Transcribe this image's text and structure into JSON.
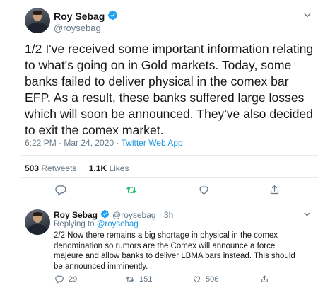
{
  "main_tweet": {
    "author_name": "Roy Sebag",
    "handle": "@roysebag",
    "text": "1/2 I've received some important information relating to what's going on in Gold markets. Today, some banks failed to deliver physical in the comex bar EFP. As a result, these banks suffered large losses which will soon be announced. They've also decided to exit the comex market.",
    "time": "6:22 PM · Mar 24, 2020 · ",
    "source": "Twitter Web App",
    "retweets_count": "503",
    "retweets_label": "Retweets",
    "likes_count": "1.1K",
    "likes_label": "Likes"
  },
  "reply_tweet": {
    "author_name": "Roy Sebag",
    "handle": "@roysebag",
    "age": "· 3h",
    "replying_prefix": "Replying to ",
    "replying_to": "@roysebag",
    "text": "2/2 Now there remains a big shortage in physical in the comex denomination so rumors are the Comex will announce a force majeure and allow banks to deliver LBMA bars instead. This should be announced imminently.",
    "reply_count": "29",
    "retweet_count": "151",
    "like_count": "506"
  },
  "colors": {
    "accent": "#1da1f2",
    "retweet_green": "#17bf63",
    "secondary_text": "#657786"
  }
}
